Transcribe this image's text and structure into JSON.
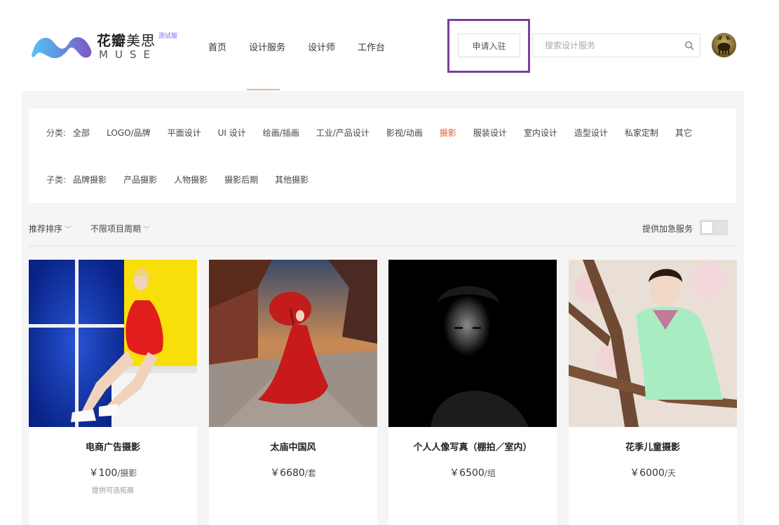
{
  "brand": {
    "name_bold": "花瓣",
    "name_light": "美思",
    "beta": "测试版",
    "subtitle": "MUSE",
    "logo_colors": [
      "#4fc3f7",
      "#7e57c2"
    ]
  },
  "nav": {
    "items": [
      {
        "label": "首页"
      },
      {
        "label": "设计服务"
      },
      {
        "label": "设计师"
      },
      {
        "label": "工作台"
      }
    ],
    "active_index": 1
  },
  "header": {
    "apply_label": "申请入驻",
    "search_placeholder": "搜索设计服务"
  },
  "filters": {
    "category_label": "分类:",
    "categories": [
      "全部",
      "LOGO/品牌",
      "平面设计",
      "UI 设计",
      "绘画/插画",
      "工业/产品设计",
      "影视/动画",
      "摄影",
      "服装设计",
      "室内设计",
      "造型设计",
      "私家定制",
      "其它"
    ],
    "active_category": "摄影",
    "subcategory_label": "子类:",
    "subcategories": [
      "品牌摄影",
      "产品摄影",
      "人物摄影",
      "摄影后期",
      "其他摄影"
    ]
  },
  "sortbar": {
    "sort_label": "推荐排序",
    "period_label": "不限项目周期",
    "urgent_label": "提供加急服务",
    "urgent_enabled": false
  },
  "products": [
    {
      "title": "电商广告摄影",
      "price": "￥100",
      "unit": "/摄影",
      "note": "提供可选拓展"
    },
    {
      "title": "太庙中国风",
      "price": "￥6680",
      "unit": "/套",
      "note": ""
    },
    {
      "title": "个人人像写真（棚拍／室内）",
      "price": "￥6500",
      "unit": "/组",
      "note": ""
    },
    {
      "title": "花季儿童摄影",
      "price": "￥6000",
      "unit": "/天",
      "note": ""
    }
  ],
  "colors": {
    "accent": "#e0612a",
    "highlight_border": "#7b3f9e",
    "nav_indicator": "#e8b48a"
  }
}
